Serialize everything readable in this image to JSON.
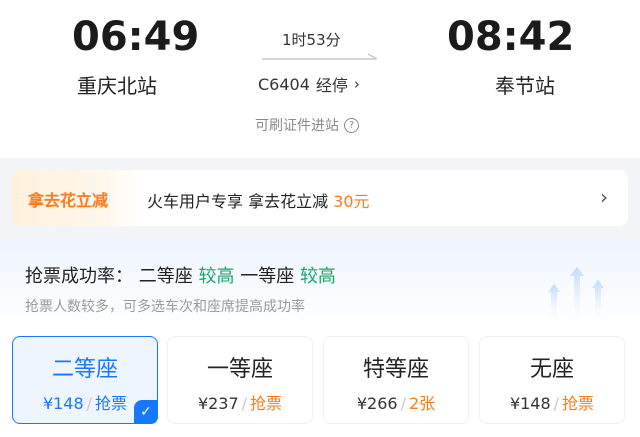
{
  "trip": {
    "departure_time": "06:49",
    "departure_station": "重庆北站",
    "arrival_time": "08:42",
    "arrival_station": "奉节站",
    "duration": "1时53分",
    "train_number": "C6404",
    "stops_label": "经停",
    "stops_chevron": "›",
    "id_entry": "可刷证件进站",
    "help_icon_glyph": "?"
  },
  "promo": {
    "tag": "拿去花立减",
    "text": "火车用户专享 拿去花立减",
    "amount": "30元",
    "chevron": "›",
    "accent_color": "#ff7a1a"
  },
  "success_rate": {
    "label": "抢票成功率：",
    "second_class": "二等座",
    "second_class_rate": "较高",
    "first_class": "一等座",
    "first_class_rate": "较高",
    "hint": "抢票人数较多，可多选车次和座席提高成功率",
    "rate_color": "#1aa56a"
  },
  "seats": [
    {
      "name": "二等座",
      "price": "¥148",
      "status": "抢票",
      "selected": true
    },
    {
      "name": "一等座",
      "price": "¥237",
      "status": "抢票",
      "selected": false
    },
    {
      "name": "特等座",
      "price": "¥266",
      "status": "2张",
      "selected": false
    },
    {
      "name": "无座",
      "price": "¥148",
      "status": "抢票",
      "selected": false
    }
  ],
  "seat_separator": "/",
  "check_glyph": "✓",
  "selected_color": "#1677ff"
}
